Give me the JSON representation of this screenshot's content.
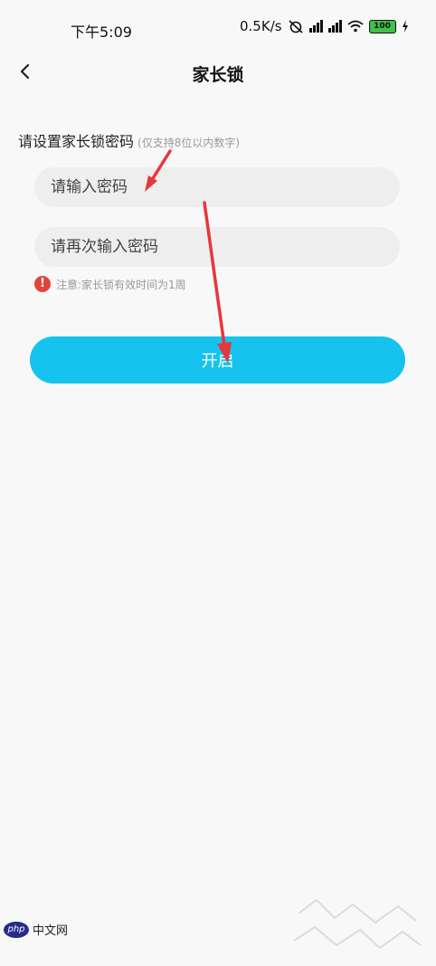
{
  "status_bar": {
    "time": "下午5:09",
    "net_speed": "0.5K/s",
    "battery_level": "100"
  },
  "nav": {
    "title": "家长锁"
  },
  "form": {
    "label": "请设置家长锁密码",
    "hint": "(仅支持8位以内数字)",
    "password_placeholder": "请输入密码",
    "confirm_placeholder": "请再次输入密码",
    "notice": "注意:家长锁有效时间为1周"
  },
  "actions": {
    "enable_label": "开启"
  },
  "watermark": {
    "logo_text": "php",
    "site_text": "中文网"
  },
  "colors": {
    "accent": "#16c3ee",
    "background": "#f8f8f8",
    "input_bg": "#eeeeee",
    "warning": "#e2443c",
    "annotation_arrow": "#e8363b"
  }
}
